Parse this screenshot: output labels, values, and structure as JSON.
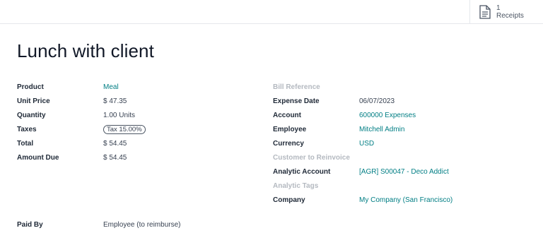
{
  "header": {
    "receipts": {
      "count": "1",
      "label": "Receipts",
      "icon": "document-icon"
    }
  },
  "title": "Lunch with client",
  "left_fields": [
    {
      "label": "Product",
      "value": "Meal",
      "link": true
    },
    {
      "label": "Unit Price",
      "value": "$ 47.35",
      "link": false
    },
    {
      "label": "Quantity",
      "value": "1.00 Units",
      "link": false
    },
    {
      "label": "Taxes",
      "value": "Tax 15.00%",
      "badge": true
    },
    {
      "label": "Total",
      "value": "$ 54.45",
      "link": false
    },
    {
      "label": "Amount Due",
      "value": "$ 54.45",
      "link": false
    }
  ],
  "right_fields": [
    {
      "label": "Bill Reference",
      "value": "",
      "muted": true
    },
    {
      "label": "Expense Date",
      "value": "06/07/2023",
      "link": false
    },
    {
      "label": "Account",
      "value": "600000 Expenses",
      "link": true
    },
    {
      "label": "Employee",
      "value": "Mitchell Admin",
      "link": true
    },
    {
      "label": "Currency",
      "value": "USD",
      "link": true
    },
    {
      "label": "Customer to Reinvoice",
      "value": "",
      "muted": true
    },
    {
      "label": "Analytic Account",
      "value": "[AGR] S00047 - Deco Addict",
      "link": true
    },
    {
      "label": "Analytic Tags",
      "value": "",
      "muted": true
    },
    {
      "label": "Company",
      "value": "My Company (San Francisco)",
      "link": true
    }
  ],
  "paid_by": {
    "label": "Paid By",
    "value": "Employee (to reimburse)"
  },
  "colors": {
    "link": "#017e84",
    "muted_label": "#b4b9c0"
  }
}
